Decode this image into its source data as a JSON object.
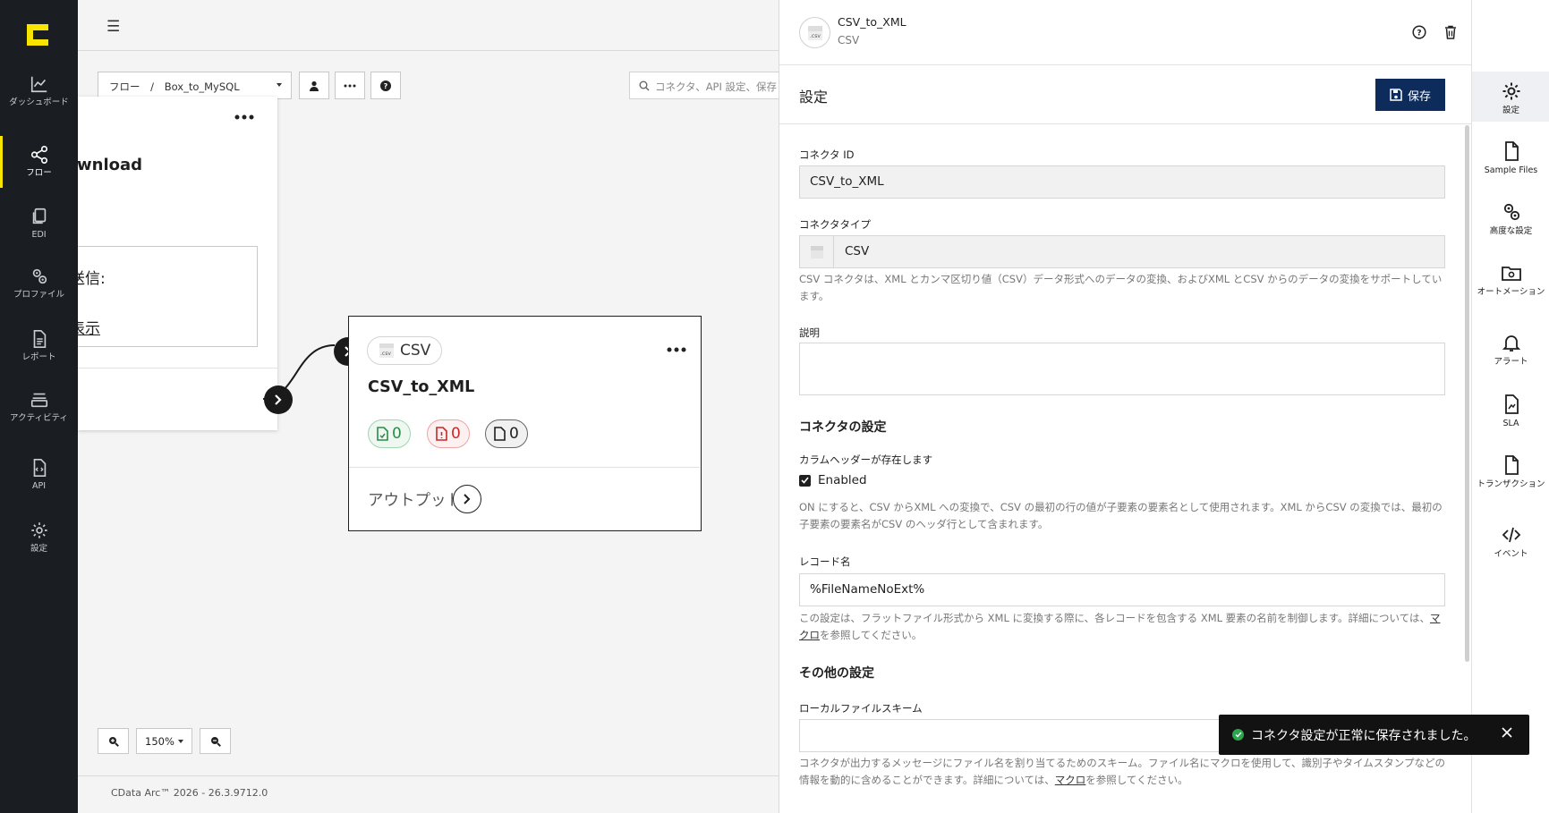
{
  "nav": {
    "items": [
      {
        "label": "ダッシュボード",
        "icon": "chart-line-icon"
      },
      {
        "label": "フロー",
        "icon": "share-nodes-icon"
      },
      {
        "label": "EDI",
        "icon": "documents-icon"
      },
      {
        "label": "プロファイル",
        "icon": "gears-icon"
      },
      {
        "label": "レポート",
        "icon": "report-icon"
      },
      {
        "label": "アクティビティ",
        "icon": "layers-icon"
      },
      {
        "label": "API",
        "icon": "api-file-icon"
      },
      {
        "label": "設定",
        "icon": "gear-icon"
      }
    ],
    "active": "フロー",
    "accent": "#f7e500"
  },
  "toolbar": {
    "breadcrumb_root": "フロー",
    "breadcrumb_sep": "/",
    "breadcrumb_flow": "Box_to_MySQL",
    "search_placeholder": "コネクタ、API 設定、保存"
  },
  "canvas": {
    "left_card": {
      "title_partial": "wnload",
      "box_line1": "送信:",
      "box_line2": "表示"
    },
    "csv_card": {
      "badge_label": "CSV",
      "badge_file_text": ".csv",
      "title": "CSV_to_XML",
      "success_count": "0",
      "error_count": "0",
      "pending_count": "0",
      "output_label": "アウトプット"
    },
    "zoom_level": "150%",
    "version": "CData Arc™ 2026 - 26.3.9712.0"
  },
  "panel": {
    "connector_name": "CSV_to_XML",
    "connector_type": "CSV",
    "avatar_text": ".csv",
    "settings_title": "設定",
    "save_label": "保存",
    "save_color": "#0d2c5c",
    "fields": {
      "connector_id_label": "コネクタ ID",
      "connector_id_value": "CSV_to_XML",
      "connector_type_label": "コネクタタイプ",
      "connector_type_value": "CSV",
      "connector_type_help": "CSV コネクタは、XML とカンマ区切り値（CSV）データ形式へのデータの変換、およびXML とCSV からのデータの変換をサポートしています。",
      "description_label": "説明",
      "description_value": "",
      "section_connector": "コネクタの設定",
      "header_label": "カラムヘッダーが存在します",
      "header_checkbox": "Enabled",
      "header_help": "ON にすると、CSV からXML への変換で、CSV の最初の行の値が子要素の要素名として使用されます。XML からCSV の変換では、最初の子要素の要素名がCSV のヘッダ行として含まれます。",
      "record_label": "レコード名",
      "record_value": "%FileNameNoExt%",
      "record_help_a": "この設定は、フラットファイル形式から XML に変換する際に、各レコードを包含する XML 要素の名前を制御します。詳細については、",
      "record_help_link": "マクロ",
      "record_help_b": "を参照してください。",
      "section_other": "その他の設定",
      "local_scheme_label": "ローカルファイルスキーム",
      "local_scheme_value": "",
      "local_scheme_help_a": "コネクタが出力するメッセージにファイル名を割り当てるためのスキーム。ファイル名にマクロを使用して、識別子やタイムスタンプなどの情報を動的に含めることができます。詳細については、",
      "local_scheme_help_link": "マクロ",
      "local_scheme_help_b": "を参照してください。"
    }
  },
  "rail": {
    "items": [
      {
        "label": "設定",
        "icon": "gear-icon"
      },
      {
        "label": "Sample Files",
        "icon": "file-icon"
      },
      {
        "label": "高度な設定",
        "icon": "gears-icon"
      },
      {
        "label": "オートメーション",
        "icon": "folder-gear-icon"
      },
      {
        "label": "アラート",
        "icon": "bell-icon"
      },
      {
        "label": "SLA",
        "icon": "sla-file-icon"
      },
      {
        "label": "トランザクション",
        "icon": "transaction-file-icon"
      },
      {
        "label": "イベント",
        "icon": "code-icon"
      }
    ]
  },
  "toast": {
    "message": "コネクタ設定が正常に保存されました。",
    "status_color": "#2da44e"
  }
}
